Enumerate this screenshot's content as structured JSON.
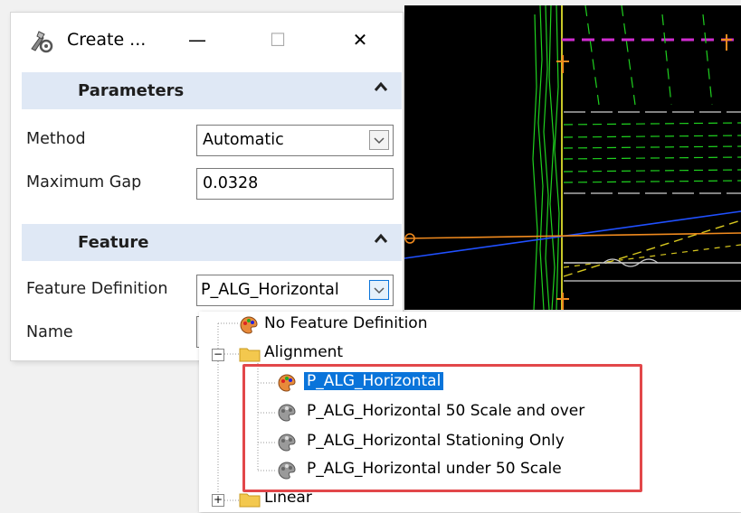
{
  "window": {
    "title": "Create ...",
    "minimize_glyph": "—",
    "maximize_glyph": "☐",
    "close_glyph": "✕"
  },
  "parameters": {
    "heading": "Parameters",
    "method_label": "Method",
    "method_value": "Automatic",
    "max_gap_label": "Maximum Gap",
    "max_gap_value": "0.0328"
  },
  "feature": {
    "heading": "Feature",
    "definition_label": "Feature Definition",
    "definition_value": "P_ALG_Horizontal",
    "name_label": "Name"
  },
  "tree": {
    "items": [
      {
        "label": "No Feature Definition",
        "icon": "palette-icon"
      },
      {
        "label": "Alignment",
        "icon": "folder-icon",
        "expander": "−"
      },
      {
        "label": "P_ALG_Horizontal",
        "icon": "palette-icon",
        "selected": true
      },
      {
        "label": "P_ALG_Horizontal 50 Scale and over",
        "icon": "palette-gray-icon"
      },
      {
        "label": "P_ALG_Horizontal Stationing Only",
        "icon": "palette-gray-icon"
      },
      {
        "label": "P_ALG_Horizontal under 50 Scale",
        "icon": "palette-gray-icon"
      },
      {
        "label": "Linear",
        "icon": "folder-icon",
        "expander": "+"
      }
    ]
  },
  "colors": {
    "section_header": "#dfe8f5",
    "selection": "#0a74da",
    "highlight_box": "#e2474a",
    "cad_background": "#000000"
  }
}
